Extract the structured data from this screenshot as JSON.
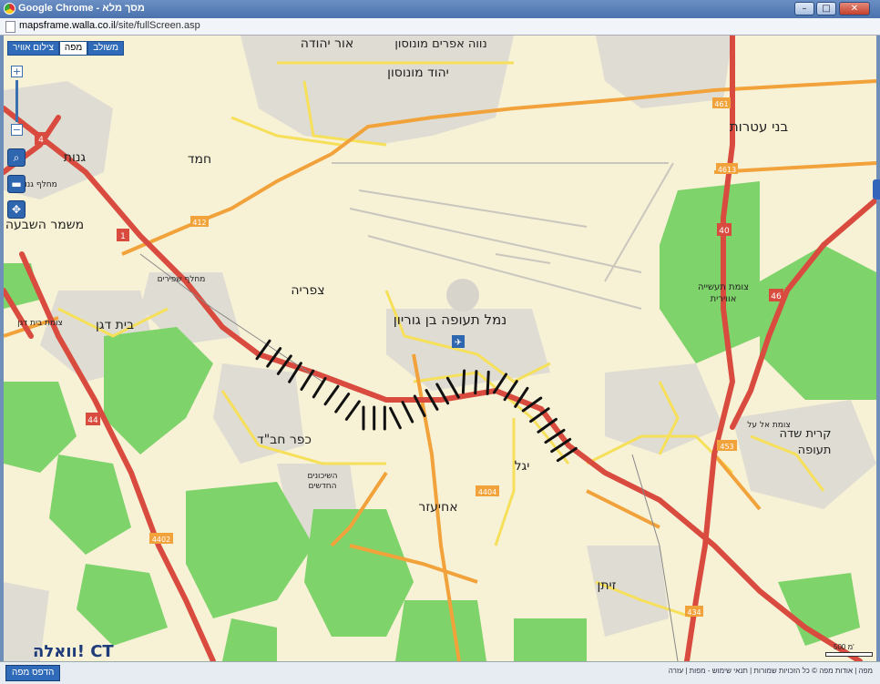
{
  "window": {
    "title": "Google Chrome - מסך מלא",
    "url_host": "mapsframe.walla.co.il",
    "url_path": "/site/fullScreen.asp",
    "min_glyph": "–",
    "max_glyph": "□",
    "close_glyph": "✕"
  },
  "toolbar": {
    "tabs": [
      {
        "label": "צילום אוויר",
        "active": false
      },
      {
        "label": "מפה",
        "active": true
      },
      {
        "label": "משולב",
        "active": false
      }
    ],
    "zoom_in": "+",
    "zoom_out": "−"
  },
  "map": {
    "colors": {
      "background": "#f7f1d6",
      "green": "#7ed36a",
      "highway": "#d94b3f",
      "main_road": "#f2a23a",
      "local_road": "#f6e05a",
      "marking": "#111111"
    },
    "labels": {
      "or_yehuda": "אור יהודה",
      "neve_efraim": "נווה אפרים מונוסון",
      "yehud": "יהוד מונוסון",
      "ganot": "גנות",
      "hemed": "חמד",
      "mishmar": "משמר השבעה",
      "bnei_atarot": "בני עטרות",
      "tzafria": "צפריה",
      "airport": "נמל תעופה בן גוריון",
      "beit_dagan": "בית דגן",
      "kfar_chabad": "כפר חב\"ד",
      "yagel": "יגל",
      "achiezer": "אחיעזר",
      "zeitan": "זיתן",
      "kiryat_sde": "קרית שדה",
      "teufa": "תעופה",
      "tzomet_taasia": "צומת תעשייה",
      "airit": "אווירית",
      "mehlaf_shafirim": "מחלף שפירים",
      "mehlaf_ganot": "מחלף גנות",
      "tzomet_beit_dagan": "צומת בית דגן",
      "tzomet_el_al": "צומת אל על",
      "hashikunim": "השיכונים",
      "hahadashim": "החדשים"
    },
    "road_numbers": [
      "4",
      "1",
      "412",
      "461",
      "40",
      "4613",
      "46",
      "453",
      "44",
      "4402",
      "4404",
      "434"
    ]
  },
  "logo_text": "וואלה! CT",
  "scale_label": "500 מ'",
  "status": {
    "print_label": "הדפס מפה",
    "footer_links": "מפה | אודות מפה © כל הזכויות שמורות | תנאי שימוש - מפות | עזרה"
  }
}
